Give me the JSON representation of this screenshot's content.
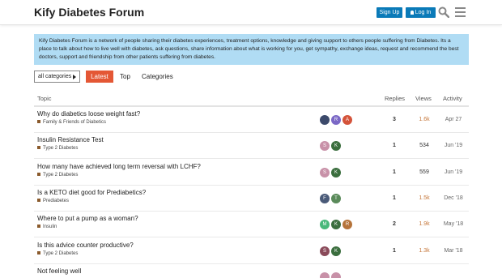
{
  "header": {
    "title": "Kify Diabetes Forum",
    "signup_label": "Sign Up",
    "login_label": "Log In"
  },
  "banner": {
    "text": "Kify Diabetes Forum is a network of people sharing their diabetes experiences, treatment options, knowledge and giving support to others people suffering from Diabetes. Its a place to talk about how to live well with diabetes, ask questions, share information about what is working for you, get sympathy, exchange ideas, request and recommend the best doctors, support and friendship from other patients suffering from diabetes."
  },
  "nav": {
    "category_select": "all categories",
    "tabs": [
      {
        "label": "Latest",
        "active": true
      },
      {
        "label": "Top",
        "active": false
      },
      {
        "label": "Categories",
        "active": false
      }
    ]
  },
  "table": {
    "headers": {
      "topic": "Topic",
      "replies": "Replies",
      "views": "Views",
      "activity": "Activity"
    },
    "rows": [
      {
        "title": "Why do diabetics loose weight fast?",
        "category": "Family & Friends of Diabetics",
        "category_color": "#8a5a2c",
        "posters": [
          {
            "letter": "",
            "color": "#3c4a6b"
          },
          {
            "letter": "R",
            "color": "#7b68c6"
          },
          {
            "letter": "A",
            "color": "#d4533a"
          }
        ],
        "replies": "3",
        "views": "1.6k",
        "views_hot": true,
        "activity": "Apr 27"
      },
      {
        "title": "Insulin Resistance Test",
        "category": "Type 2 Diabetes",
        "category_color": "#8a5a2c",
        "posters": [
          {
            "letter": "S",
            "color": "#c891a8"
          },
          {
            "letter": "K",
            "color": "#3b6e3e"
          }
        ],
        "replies": "1",
        "views": "534",
        "views_hot": false,
        "activity": "Jun '19"
      },
      {
        "title": "How many have achieved long term reversal with LCHF?",
        "category": "Type 2 Diabetes",
        "category_color": "#8a5a2c",
        "posters": [
          {
            "letter": "S",
            "color": "#c891a8"
          },
          {
            "letter": "K",
            "color": "#3b6e3e"
          }
        ],
        "replies": "1",
        "views": "559",
        "views_hot": false,
        "activity": "Jun '19"
      },
      {
        "title": "Is a KETO diet good for Prediabetics?",
        "category": "Prediabetes",
        "category_color": "#8a5a2c",
        "posters": [
          {
            "letter": "F",
            "color": "#4a5a78"
          },
          {
            "letter": "T",
            "color": "#5a8a5a"
          }
        ],
        "replies": "1",
        "views": "1.5k",
        "views_hot": true,
        "activity": "Dec '18"
      },
      {
        "title": "Where to put a pump as a woman?",
        "category": "Insulin",
        "category_color": "#8a5a2c",
        "posters": [
          {
            "letter": "M",
            "color": "#48b87a"
          },
          {
            "letter": "K",
            "color": "#3b6e3e"
          },
          {
            "letter": "R",
            "color": "#b5733a"
          }
        ],
        "replies": "2",
        "views": "1.9k",
        "views_hot": true,
        "activity": "May '18"
      },
      {
        "title": "Is this advice counter productive?",
        "category": "Type 2 Diabetes",
        "category_color": "#8a5a2c",
        "posters": [
          {
            "letter": "S",
            "color": "#8a4a5a"
          },
          {
            "letter": "K",
            "color": "#3b6e3e"
          }
        ],
        "replies": "1",
        "views": "1.3k",
        "views_hot": true,
        "activity": "Mar '18"
      },
      {
        "title": "Not feeling well",
        "category": "",
        "category_color": "#8a5a2c",
        "posters": [
          {
            "letter": "",
            "color": "#c891a8"
          },
          {
            "letter": "",
            "color": "#c891a8"
          }
        ],
        "replies": "",
        "views": "",
        "views_hot": false,
        "activity": ""
      }
    ]
  }
}
